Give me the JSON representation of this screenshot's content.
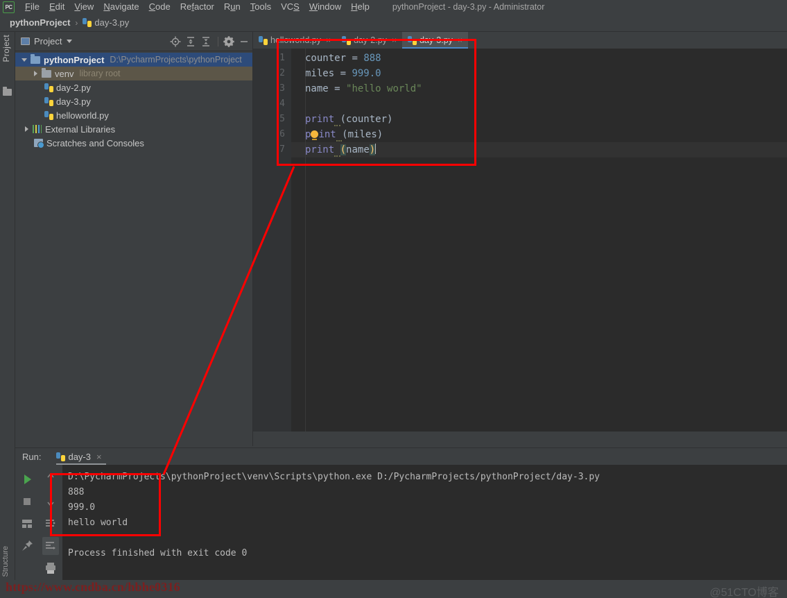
{
  "window": {
    "title": "pythonProject - day-3.py - Administrator",
    "logo": "pycharm-logo"
  },
  "menu": {
    "items": [
      {
        "label": "File"
      },
      {
        "label": "Edit"
      },
      {
        "label": "View"
      },
      {
        "label": "Navigate"
      },
      {
        "label": "Code"
      },
      {
        "label": "Refactor"
      },
      {
        "label": "Run"
      },
      {
        "label": "Tools"
      },
      {
        "label": "VCS"
      },
      {
        "label": "Window"
      },
      {
        "label": "Help"
      }
    ]
  },
  "breadcrumb": {
    "root": "pythonProject",
    "separator": "›",
    "file": "day-3.py"
  },
  "left_strip": {
    "project_label": "Project",
    "structure_label": "Structure",
    "folder_icon": "folder-icon"
  },
  "project_panel": {
    "title": "Project",
    "icons": [
      {
        "name": "locate-icon"
      },
      {
        "name": "expand-all-icon"
      },
      {
        "name": "collapse-all-icon"
      },
      {
        "name": "gear-icon"
      },
      {
        "name": "minimize-icon"
      }
    ],
    "tree": [
      {
        "label": "pythonProject",
        "path": "D:\\PycharmProjects\\pythonProject",
        "icon": "folder-icon",
        "state": "selected",
        "arrow": "open",
        "depth": 0
      },
      {
        "label": "venv",
        "path": "library root",
        "icon": "folder-icon",
        "state": "venv",
        "arrow": "closed",
        "depth": 1
      },
      {
        "label": "day-2.py",
        "path": "",
        "icon": "python-file-icon",
        "state": "",
        "arrow": "",
        "depth": 2
      },
      {
        "label": "day-3.py",
        "path": "",
        "icon": "python-file-icon",
        "state": "",
        "arrow": "",
        "depth": 2
      },
      {
        "label": "helloworld.py",
        "path": "",
        "icon": "python-file-icon",
        "state": "",
        "arrow": "",
        "depth": 2
      },
      {
        "label": "External Libraries",
        "path": "",
        "icon": "library-icon",
        "state": "",
        "arrow": "closed",
        "depth": 0
      },
      {
        "label": "Scratches and Consoles",
        "path": "",
        "icon": "scratches-icon",
        "state": "",
        "arrow": "",
        "depth": 0
      }
    ]
  },
  "editor": {
    "tabs": [
      {
        "label": "helloworld.py",
        "active": false,
        "close": "×"
      },
      {
        "label": "day-2.py",
        "active": false,
        "close": "×"
      },
      {
        "label": "day-3.py",
        "active": true,
        "close": "×"
      }
    ],
    "line_numbers": [
      "1",
      "2",
      "3",
      "4",
      "5",
      "6",
      "7"
    ],
    "code_lines": [
      {
        "n": 1,
        "text": "counter = 888"
      },
      {
        "n": 2,
        "text": "miles = 999.0"
      },
      {
        "n": 3,
        "text": "name = \"hello world\""
      },
      {
        "n": 4,
        "text": ""
      },
      {
        "n": 5,
        "text": "print (counter)"
      },
      {
        "n": 6,
        "text": "print (miles)"
      },
      {
        "n": 7,
        "text": "print (name)"
      }
    ],
    "current_line": 7,
    "inspection_bulb_line": 6
  },
  "run_panel": {
    "label": "Run:",
    "tab": "day-3",
    "tab_close": "×",
    "toolbar_left": [
      {
        "name": "rerun-play-icon"
      },
      {
        "name": "stop-icon"
      },
      {
        "name": "layout-icon"
      },
      {
        "name": "pin-icon"
      }
    ],
    "toolbar_right": [
      {
        "name": "scroll-up-icon"
      },
      {
        "name": "scroll-down-icon"
      },
      {
        "name": "soft-wrap-icon"
      },
      {
        "name": "scroll-to-end-icon"
      },
      {
        "name": "print-icon"
      },
      {
        "name": "trash-icon"
      }
    ],
    "console_lines": [
      "D:\\PycharmProjects\\pythonProject\\venv\\Scripts\\python.exe D:/PycharmProjects/pythonProject/day-3.py",
      "888",
      "999.0",
      "hello world",
      "",
      "Process finished with exit code 0"
    ]
  },
  "watermarks": {
    "url": "https://www.cndba.cn/hbhe0316",
    "site": "@51CTO博客"
  },
  "colors": {
    "accent": "#4a88c7",
    "annotation": "#ff0000",
    "editor_bg": "#2b2b2b",
    "panel_bg": "#3c3f41",
    "number_token": "#6897bb",
    "string_token": "#6a8759",
    "function_token": "#8888c6"
  }
}
